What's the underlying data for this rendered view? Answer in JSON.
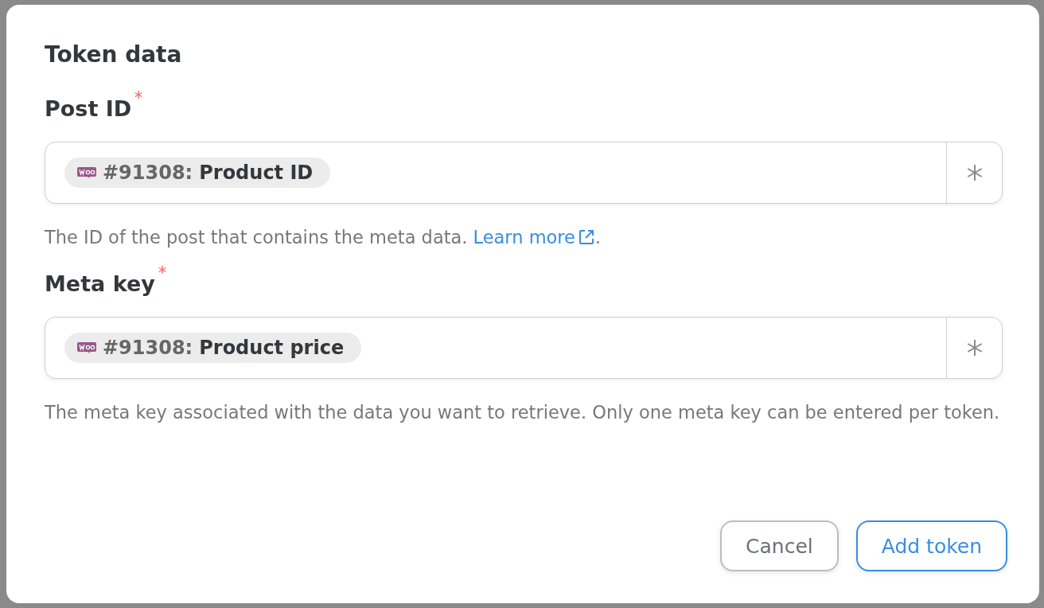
{
  "dialog": {
    "title": "Token data",
    "fields": [
      {
        "label": "Post ID",
        "required": true,
        "token": {
          "source": "#91308:",
          "name": "Product ID"
        },
        "help": "The ID of the post that contains the meta data. ",
        "link": "Learn more",
        "help_end": "."
      },
      {
        "label": "Meta key",
        "required": true,
        "token": {
          "source": "#91308:",
          "name": "Product price"
        },
        "help": "The meta key associated with the data you want to retrieve. Only one meta key can be entered per token."
      }
    ],
    "buttons": [
      {
        "label": "Cancel",
        "kind": "secondary"
      },
      {
        "label": "Add token",
        "kind": "primary"
      }
    ]
  }
}
